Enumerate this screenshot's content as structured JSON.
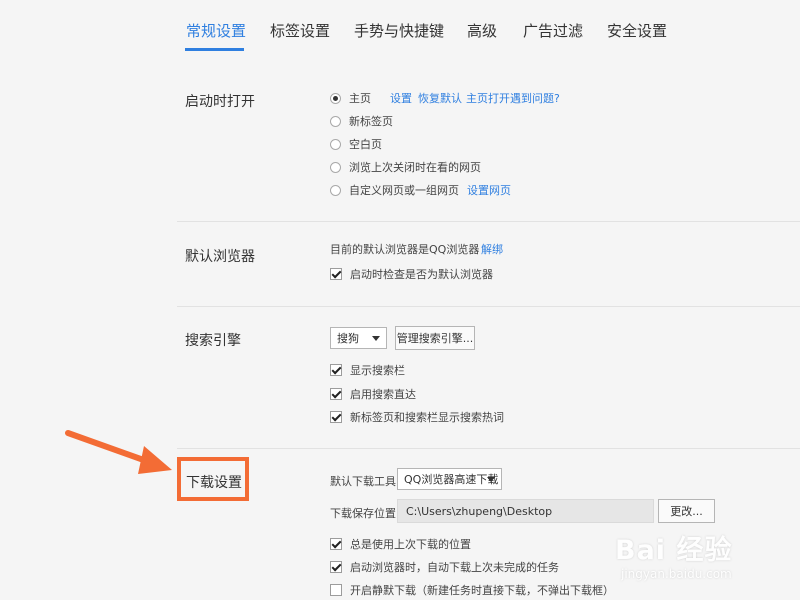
{
  "tabs": [
    {
      "label": "常规设置",
      "active": true
    },
    {
      "label": "标签设置",
      "active": false
    },
    {
      "label": "手势与快捷键",
      "active": false
    },
    {
      "label": "高级",
      "active": false
    },
    {
      "label": "广告过滤",
      "active": false
    },
    {
      "label": "安全设置",
      "active": false
    }
  ],
  "startup": {
    "title": "启动时打开",
    "options": [
      "主页",
      "新标签页",
      "空白页",
      "浏览上次关闭时在看的网页",
      "自定义网页或一组网页"
    ],
    "selected": "主页",
    "links": {
      "settings": "设置",
      "restore": "恢复默认",
      "problem": "主页打开遇到问题?",
      "set_pages": "设置网页"
    }
  },
  "default_browser": {
    "title": "默认浏览器",
    "status": "目前的默认浏览器是QQ浏览器",
    "unbind": "解绑",
    "check_label": "启动时检查是否为默认浏览器",
    "check_checked": true
  },
  "search": {
    "title": "搜索引擎",
    "engine": "搜狗",
    "manage_button": "管理搜索引擎...",
    "options": [
      {
        "label": "显示搜索栏",
        "checked": true
      },
      {
        "label": "启用搜索直达",
        "checked": true
      },
      {
        "label": "新标签页和搜索栏显示搜索热词",
        "checked": true
      }
    ]
  },
  "download": {
    "title": "下载设置",
    "tool_label": "默认下载工具",
    "tool_value": "QQ浏览器高速下载",
    "path_label": "下载保存位置",
    "path_value": "C:\\Users\\zhupeng\\Desktop",
    "change_button": "更改...",
    "options": [
      {
        "label": "总是使用上次下载的位置",
        "checked": true
      },
      {
        "label": "启动浏览器时，自动下载上次未完成的任务",
        "checked": true
      },
      {
        "label": "开启静默下载（新建任务时直接下载，不弹出下载框）",
        "checked": false
      }
    ]
  },
  "annotation": {
    "color": "#f36c35"
  },
  "watermark": {
    "main": "Bai 经验",
    "sub": "jingyan.baidu.com"
  },
  "colors": {
    "accent": "#2f7fe0",
    "highlight": "#f36c35"
  }
}
